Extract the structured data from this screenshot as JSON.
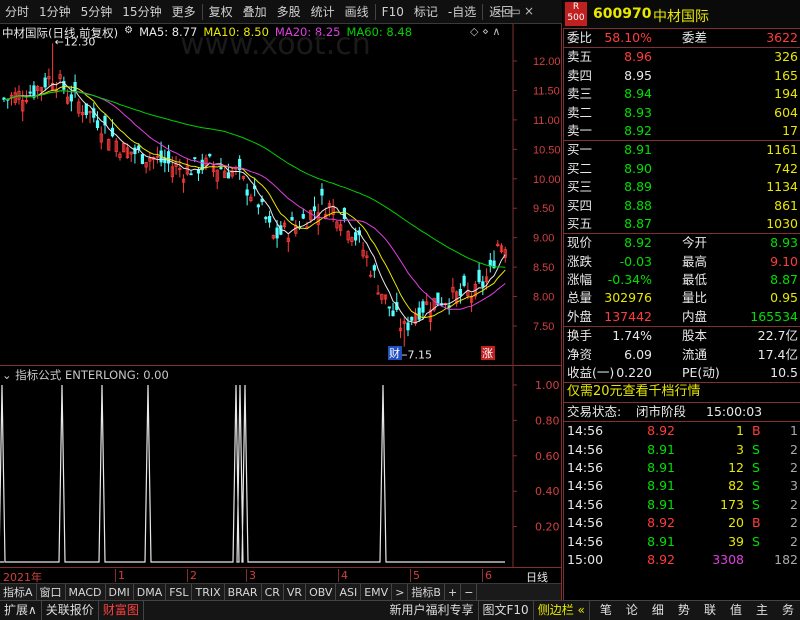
{
  "toolbar": {
    "items": [
      "分时",
      "1分钟",
      "5分钟",
      "15分钟",
      "更多",
      "复权",
      "叠加",
      "多股",
      "统计",
      "画线",
      "F10",
      "标记",
      "-自选",
      "返回"
    ]
  },
  "quote_header": {
    "badge_top": "R",
    "badge_bottom": "500",
    "code": "600970",
    "name": "中材国际"
  },
  "chart": {
    "title": "中材国际(日线,前复权)",
    "ma": [
      {
        "label": "MA5: 8.77",
        "color": "#e8e8e8"
      },
      {
        "label": "MA10: 8.50",
        "color": "#e8e800"
      },
      {
        "label": "MA20: 8.25",
        "color": "#e040e0"
      },
      {
        "label": "MA60: 8.48",
        "color": "#00d000"
      }
    ],
    "high_label": "12.30",
    "low_label": "7.15",
    "watermark": "www.xoot.cn",
    "yticks": [
      "12.00",
      "11.50",
      "11.00",
      "10.50",
      "10.00",
      "9.50",
      "9.00",
      "8.50",
      "8.00",
      "7.50"
    ],
    "badge_cai": "财",
    "badge_zhang": "涨"
  },
  "indicator": {
    "title": "指标公式 ENTERLONG: 0.00",
    "yticks": [
      "1.00",
      "0.80",
      "0.60",
      "0.40",
      "0.20"
    ]
  },
  "axis": {
    "year": "2021年",
    "months": [
      "1",
      "2",
      "3",
      "4",
      "5",
      "6"
    ],
    "right": "日线"
  },
  "tabs": [
    "指标A",
    "窗口",
    "MACD",
    "DMI",
    "DMA",
    "FSL",
    "TRIX",
    "BRAR",
    "CR",
    "VR",
    "OBV",
    "ASI",
    "EMV",
    ">",
    "指标B",
    "+",
    "−"
  ],
  "bottombar": {
    "left": [
      "扩展∧",
      "关联报价",
      "财富图"
    ],
    "right": [
      "新用户福利专享",
      "图文F10",
      "侧边栏 «"
    ],
    "icons": [
      "笔",
      "论",
      "细",
      "势",
      "联",
      "值",
      "主",
      "务"
    ]
  },
  "quote": {
    "weibi": {
      "label": "委比",
      "value": "58.10%",
      "label2": "委差",
      "value2": "3622"
    },
    "asks": [
      {
        "label": "卖五",
        "price": "8.96",
        "vol": "326"
      },
      {
        "label": "卖四",
        "price": "8.95",
        "vol": "165"
      },
      {
        "label": "卖三",
        "price": "8.94",
        "vol": "194"
      },
      {
        "label": "卖二",
        "price": "8.93",
        "vol": "604"
      },
      {
        "label": "卖一",
        "price": "8.92",
        "vol": "17"
      }
    ],
    "bids": [
      {
        "label": "买一",
        "price": "8.91",
        "vol": "1161"
      },
      {
        "label": "买二",
        "price": "8.90",
        "vol": "742"
      },
      {
        "label": "买三",
        "price": "8.89",
        "vol": "1134"
      },
      {
        "label": "买四",
        "price": "8.88",
        "vol": "861"
      },
      {
        "label": "买五",
        "price": "8.87",
        "vol": "1030"
      }
    ],
    "stats": [
      {
        "l1": "现价",
        "v1": "8.92",
        "l2": "今开",
        "v2": "8.93"
      },
      {
        "l1": "涨跌",
        "v1": "-0.03",
        "l2": "最高",
        "v2": "9.10"
      },
      {
        "l1": "涨幅",
        "v1": "-0.34%",
        "l2": "最低",
        "v2": "8.87"
      },
      {
        "l1": "总量",
        "v1": "302976",
        "l2": "量比",
        "v2": "0.95"
      },
      {
        "l1": "外盘",
        "v1": "137442",
        "l2": "内盘",
        "v2": "165534"
      }
    ],
    "fin": [
      {
        "l1": "换手",
        "v1": "1.74%",
        "l2": "股本",
        "v2": "22.7亿"
      },
      {
        "l1": "净资",
        "v1": "6.09",
        "l2": "流通",
        "v2": "17.4亿"
      },
      {
        "l1": "收益(一)",
        "v1": "0.220",
        "l2": "PE(动)",
        "v2": "10.5"
      }
    ],
    "promo": "仅需20元查看千档行情",
    "status": {
      "label": "交易状态:",
      "value": "闭市阶段",
      "time": "15:00:03"
    },
    "ticks": [
      {
        "t": "14:56",
        "p": "8.92",
        "v": "1",
        "bs": "B",
        "n": "1"
      },
      {
        "t": "14:56",
        "p": "8.91",
        "v": "3",
        "bs": "S",
        "n": "2"
      },
      {
        "t": "14:56",
        "p": "8.91",
        "v": "12",
        "bs": "S",
        "n": "2"
      },
      {
        "t": "14:56",
        "p": "8.91",
        "v": "82",
        "bs": "S",
        "n": "3"
      },
      {
        "t": "14:56",
        "p": "8.91",
        "v": "173",
        "bs": "S",
        "n": "2"
      },
      {
        "t": "14:56",
        "p": "8.92",
        "v": "20",
        "bs": "B",
        "n": "2"
      },
      {
        "t": "14:56",
        "p": "8.91",
        "v": "39",
        "bs": "S",
        "n": "2"
      },
      {
        "t": "15:00",
        "p": "8.92",
        "v": "3308",
        "bs": "",
        "n": "182"
      }
    ]
  }
}
